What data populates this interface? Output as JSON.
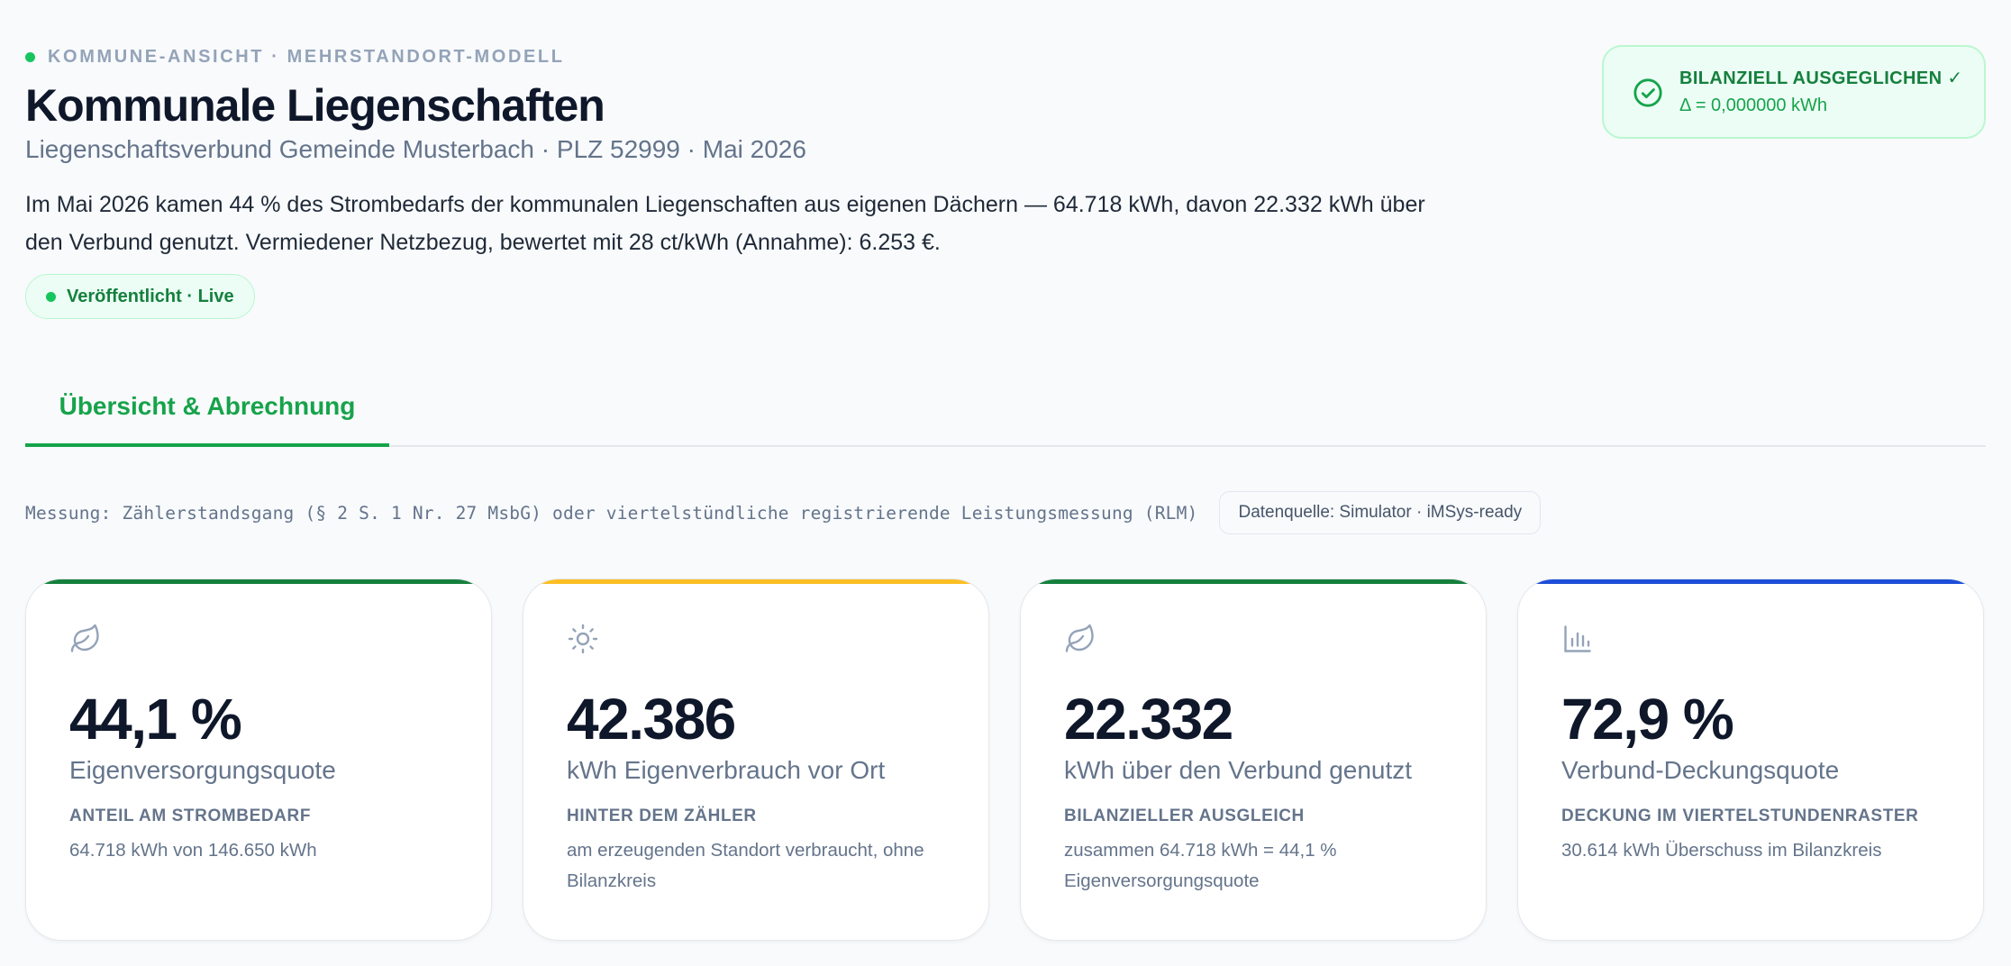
{
  "header": {
    "eyebrow": "KOMMUNE-ANSICHT · MEHRSTANDORT-MODELL",
    "title": "Kommunale Liegenschaften",
    "subtitle": "Liegenschaftsverbund Gemeinde Musterbach · PLZ 52999 · Mai 2026",
    "summary": "Im Mai 2026 kamen 44 % des Strombedarfs der kommunalen Liegenschaften aus eigenen Dächern — 64.718 kWh, davon 22.332 kWh über den Verbund genutzt. Vermiedener Netzbezug, bewertet mit 28 ct/kWh (Annahme): 6.253 €.",
    "publish_status": "Veröffentlicht · Live"
  },
  "balance_status": {
    "title": "BILANZIELL AUSGEGLICHEN ✓",
    "delta": "Δ = 0,000000 kWh",
    "icon": "check-circle-icon"
  },
  "tabs": [
    {
      "label": "Übersicht & Abrechnung",
      "active": true
    }
  ],
  "measurement": {
    "note": "Messung: Zählerstandsgang (§ 2 S. 1 Nr. 27 MsbG) oder viertelstündliche registrierende Leistungsmessung (RLM)",
    "source": "Datenquelle: Simulator · iMSys-ready"
  },
  "colors": {
    "accent_green": "#16a34a",
    "green_bar": "#15803d",
    "amber_bar": "#fbbf24",
    "blue_bar": "#1d4ed8"
  },
  "cards": [
    {
      "icon": "leaf-icon",
      "accent": "#15803d",
      "value": "44,1 %",
      "label": "Eigenversorgungsquote",
      "kicker": "ANTEIL AM STROMBEDARF",
      "description": "64.718 kWh von 146.650 kWh"
    },
    {
      "icon": "sun-icon",
      "accent": "#fbbf24",
      "value": "42.386",
      "label": "kWh Eigenverbrauch vor Ort",
      "kicker": "HINTER DEM ZÄHLER",
      "description": "am erzeugenden Standort verbraucht, ohne Bilanzkreis"
    },
    {
      "icon": "leaf-icon",
      "accent": "#15803d",
      "value": "22.332",
      "label": "kWh über den Verbund genutzt",
      "kicker": "BILANZIELLER AUSGLEICH",
      "description": "zusammen 64.718 kWh = 44,1 % Eigenversorgungsquote"
    },
    {
      "icon": "bar-chart-icon",
      "accent": "#1d4ed8",
      "value": "72,9 %",
      "label": "Verbund-Deckungsquote",
      "kicker": "DECKUNG IM VIERTELSTUNDENRASTER",
      "description": "30.614 kWh Überschuss im Bilanzkreis"
    }
  ]
}
